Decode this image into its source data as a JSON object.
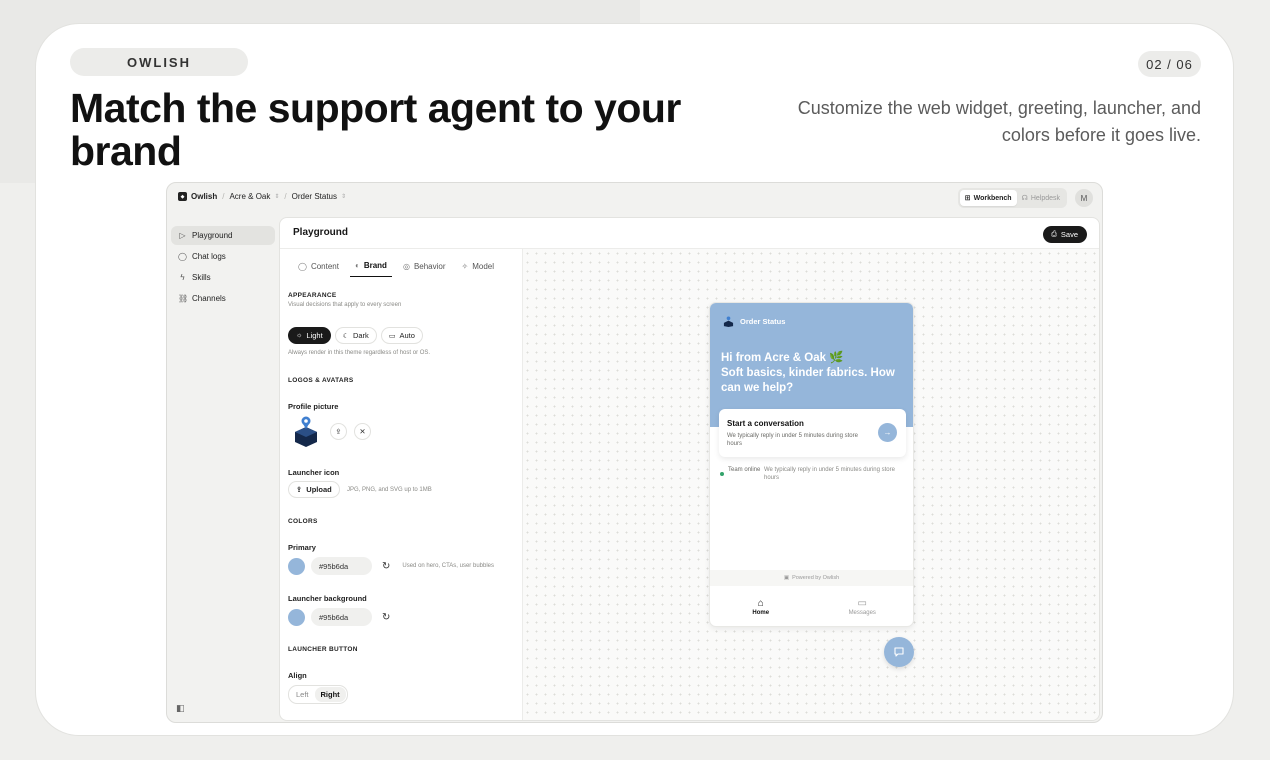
{
  "slide": {
    "brand": "OWLISH",
    "counter": "02 / 06",
    "headline": "Match the support agent to your brand",
    "subhead": "Customize the web widget, greeting, launcher, and colors before it goes live."
  },
  "topbar": {
    "crumbs": [
      "Owlish",
      "Acre & Oak",
      "Order Status"
    ],
    "modes": [
      {
        "label": "Workbench",
        "icon": "workbench-icon",
        "active": true
      },
      {
        "label": "Helpdesk",
        "icon": "headset-icon",
        "active": false
      }
    ],
    "avatar": "M"
  },
  "sidebar": {
    "items": [
      {
        "label": "Playground",
        "icon": "play-icon",
        "active": true
      },
      {
        "label": "Chat logs",
        "icon": "chat-icon",
        "active": false
      },
      {
        "label": "Skills",
        "icon": "bolt-icon",
        "active": false
      },
      {
        "label": "Channels",
        "icon": "channels-icon",
        "active": false
      }
    ]
  },
  "main": {
    "title": "Playground",
    "save_label": "Save"
  },
  "tabs": [
    {
      "label": "Content",
      "icon": "chat-icon",
      "active": false
    },
    {
      "label": "Brand",
      "icon": "palette-icon",
      "active": true
    },
    {
      "label": "Behavior",
      "icon": "behavior-icon",
      "active": false
    },
    {
      "label": "Model",
      "icon": "sparkle-icon",
      "active": false
    }
  ],
  "appearance": {
    "title": "APPEARANCE",
    "hint": "Visual decisions that apply to every screen",
    "themes": [
      {
        "label": "Light",
        "icon": "sun-icon",
        "active": true
      },
      {
        "label": "Dark",
        "icon": "moon-icon",
        "active": false
      },
      {
        "label": "Auto",
        "icon": "monitor-icon",
        "active": false
      }
    ],
    "theme_hint": "Always render in this theme regardless of host or OS."
  },
  "logos": {
    "title": "LOGOS & AVATARS",
    "profile_label": "Profile picture",
    "launcher_label": "Launcher icon",
    "upload_label": "Upload",
    "upload_hint": "JPG, PNG, and SVG up to 1MB"
  },
  "colors": {
    "title": "COLORS",
    "primary_label": "Primary",
    "primary_value": "#95b6da",
    "primary_hint": "Used on hero, CTAs, user bubbles",
    "launcher_bg_label": "Launcher background",
    "launcher_bg_value": "#95b6da",
    "accent": "#95b6da"
  },
  "launcher_button": {
    "title": "LAUNCHER BUTTON",
    "align_label": "Align",
    "options": [
      "Left",
      "Right"
    ],
    "selected": "Right"
  },
  "widget": {
    "brand": "Order Status",
    "greeting_line1": "Hi from Acre & Oak 🌿",
    "greeting_rest": "Soft basics, kinder fabrics. How can we help?",
    "card_title": "Start a conversation",
    "card_sub": "We typically reply in under 5 minutes during store hours",
    "team_status": "Team online",
    "team_reply": "We typically reply in under 5 minutes during store hours",
    "powered": "Powered by Owlish",
    "nav": [
      {
        "label": "Home",
        "icon": "home-icon",
        "active": true
      },
      {
        "label": "Messages",
        "icon": "message-icon",
        "active": false
      }
    ]
  }
}
